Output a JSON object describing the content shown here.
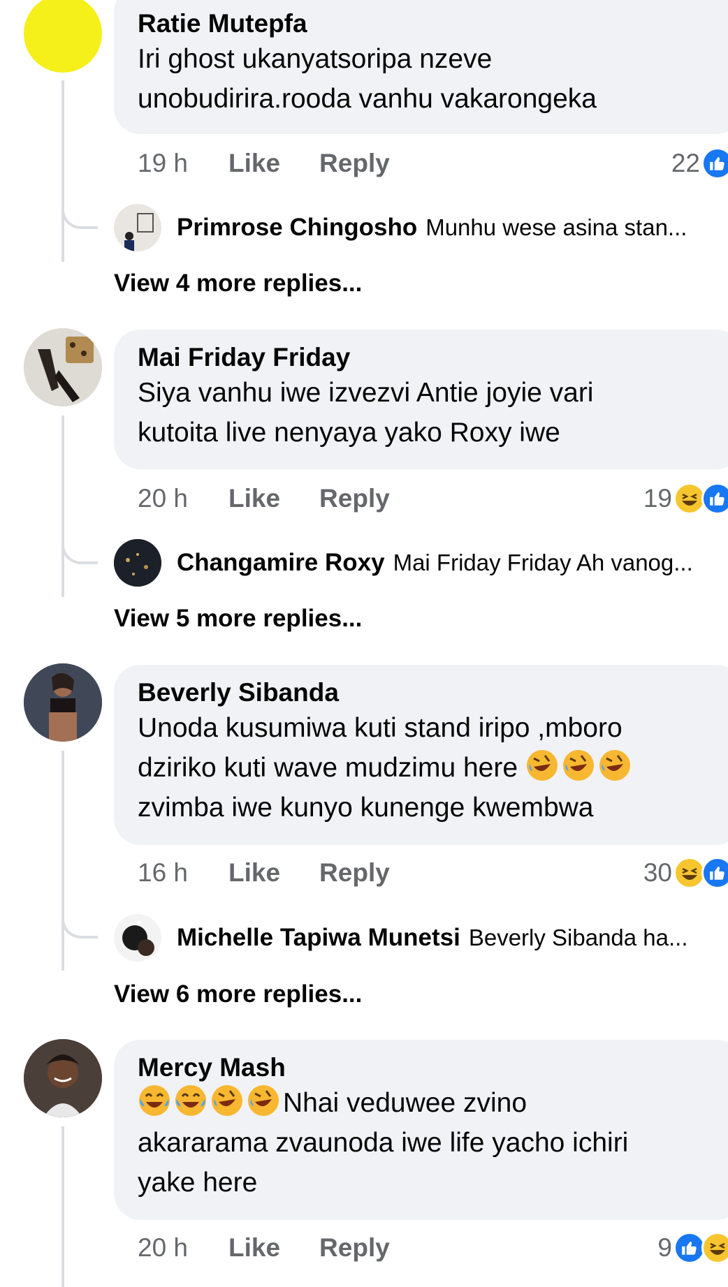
{
  "comments": [
    {
      "author": "Ratie Mutepfa",
      "lines": [
        "Iri ghost ukanyatsoripa nzeve",
        "unobudirira.rooda vanhu vakarongeka"
      ],
      "time": "19 h",
      "like_label": "Like",
      "reply_label": "Reply",
      "reaction_count": "22",
      "reactions": [
        "like"
      ],
      "reply_preview": {
        "author": "Primrose Chingosho",
        "text": "Munhu wese asina stan..."
      },
      "view_more": "View 4 more replies..."
    },
    {
      "author": "Mai Friday Friday",
      "lines": [
        "Siya vanhu iwe izvezvi Antie joyie vari",
        "kutoita live nenyaya yako Roxy iwe"
      ],
      "time": "20 h",
      "like_label": "Like",
      "reply_label": "Reply",
      "reaction_count": "19",
      "reactions": [
        "haha",
        "like"
      ],
      "reply_preview": {
        "author": "Changamire Roxy",
        "text": "Mai Friday Friday Ah vanog..."
      },
      "view_more": "View 5 more replies..."
    },
    {
      "author": "Beverly Sibanda",
      "lines": [
        "Unoda kusumiwa kuti stand iripo ,mboro",
        "dziriko kuti wave mudzimu here",
        "zvimba iwe kunyo kunenge kwembwa"
      ],
      "time": "16 h",
      "like_label": "Like",
      "reply_label": "Reply",
      "reaction_count": "30",
      "reactions": [
        "haha",
        "like"
      ],
      "reply_preview": {
        "author": "Michelle Tapiwa Munetsi",
        "text": "Beverly Sibanda ha..."
      },
      "view_more": "View 6 more replies..."
    },
    {
      "author": "Mercy Mash",
      "lines": [
        "Nhai veduwee zvino",
        "akararama zvaunoda iwe life yacho ichiri",
        "yake here"
      ],
      "time": "20 h",
      "like_label": "Like",
      "reply_label": "Reply",
      "reaction_count": "9",
      "reactions": [
        "like",
        "haha"
      ]
    }
  ],
  "colors": {
    "bubble": "#f0f2f5",
    "meta_text": "#65676b",
    "like_blue": "#1877f2",
    "haha_yellow": "#f7c62f",
    "thread_line": "#dadde1"
  }
}
